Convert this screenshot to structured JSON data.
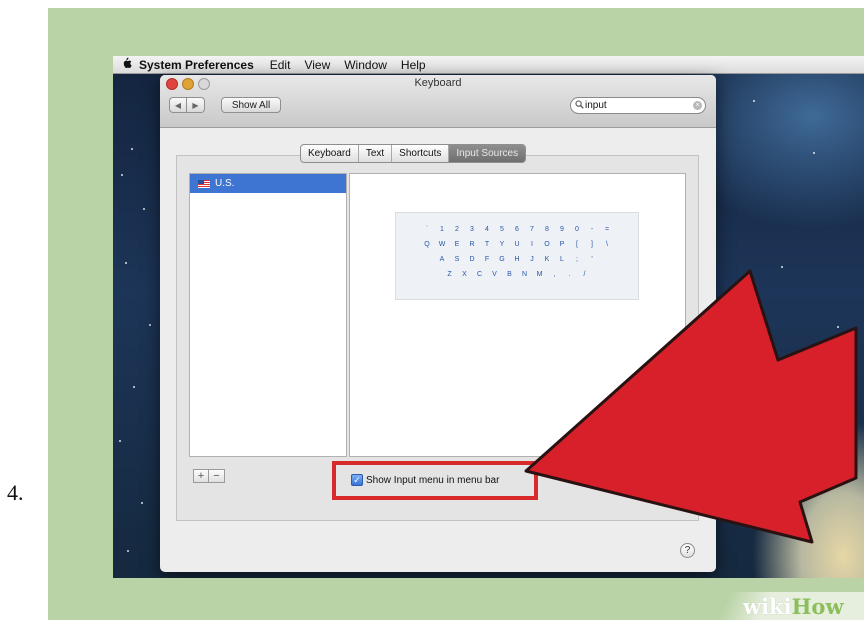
{
  "step_number": "4.",
  "menubar": {
    "apple_icon": "apple-logo",
    "app_name": "System Preferences",
    "items": [
      "Edit",
      "View",
      "Window",
      "Help"
    ]
  },
  "window": {
    "title": "Keyboard",
    "back_icon": "◀",
    "forward_icon": "▶",
    "show_all_label": "Show All",
    "search": {
      "value": "input",
      "icon": "magnifier-icon",
      "clear_icon": "clear-icon"
    },
    "tabs": [
      {
        "label": "Keyboard",
        "active": false
      },
      {
        "label": "Text",
        "active": false
      },
      {
        "label": "Shortcuts",
        "active": false
      },
      {
        "label": "Input Sources",
        "active": true
      }
    ],
    "input_sources": [
      {
        "label": "U.S.",
        "flag": "us-flag-icon",
        "selected": true
      }
    ],
    "keyboard_layout": [
      [
        "`",
        "1",
        "2",
        "3",
        "4",
        "5",
        "6",
        "7",
        "8",
        "9",
        "0",
        "-",
        "="
      ],
      [
        "Q",
        "W",
        "E",
        "R",
        "T",
        "Y",
        "U",
        "I",
        "O",
        "P",
        "[",
        "]",
        "\\"
      ],
      [
        "A",
        "S",
        "D",
        "F",
        "G",
        "H",
        "J",
        "K",
        "L",
        ";",
        "'"
      ],
      [
        "Z",
        "X",
        "C",
        "V",
        "B",
        "N",
        "M",
        ",",
        ".",
        "/"
      ]
    ],
    "add_label": "+",
    "remove_label": "−",
    "show_input_menu": {
      "label": "Show Input menu in menu bar",
      "checked": true
    },
    "help_label": "?"
  },
  "annotation": {
    "highlight_color": "#d82a2a",
    "arrow_color": "#d8202a"
  },
  "branding": {
    "part1": "wiki",
    "part2": "How"
  }
}
